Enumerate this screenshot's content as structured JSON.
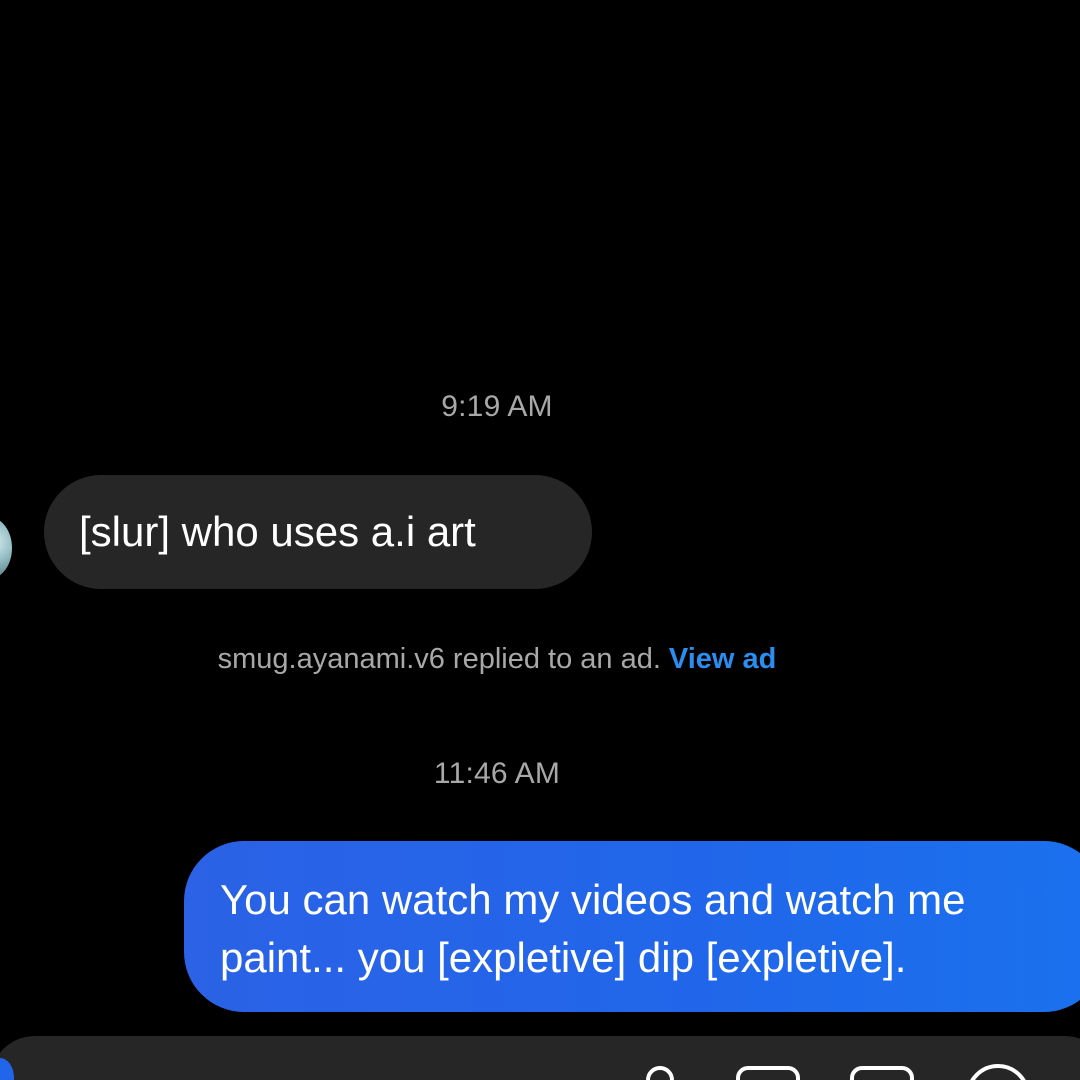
{
  "thread": {
    "timestamp_1": "9:19 AM",
    "timestamp_2": "11:46 AM",
    "incoming_message": "[slur] who uses a.i art",
    "ad_reply_text": "smug.ayanami.v6 replied to an ad.",
    "view_ad_link": "View ad",
    "outgoing_line_1": "You can watch my videos and watch me",
    "outgoing_line_2": "paint... you [expletive] dip [expletive]."
  },
  "colors": {
    "background": "#000000",
    "incoming_bubble": "#262626",
    "outgoing_bubble": "#2166ea",
    "link": "#2a8ef0",
    "meta_text": "#a8a8a8"
  },
  "composer": {
    "icons": [
      "mic-icon",
      "gallery-icon",
      "sticker-icon",
      "plus-icon"
    ]
  }
}
